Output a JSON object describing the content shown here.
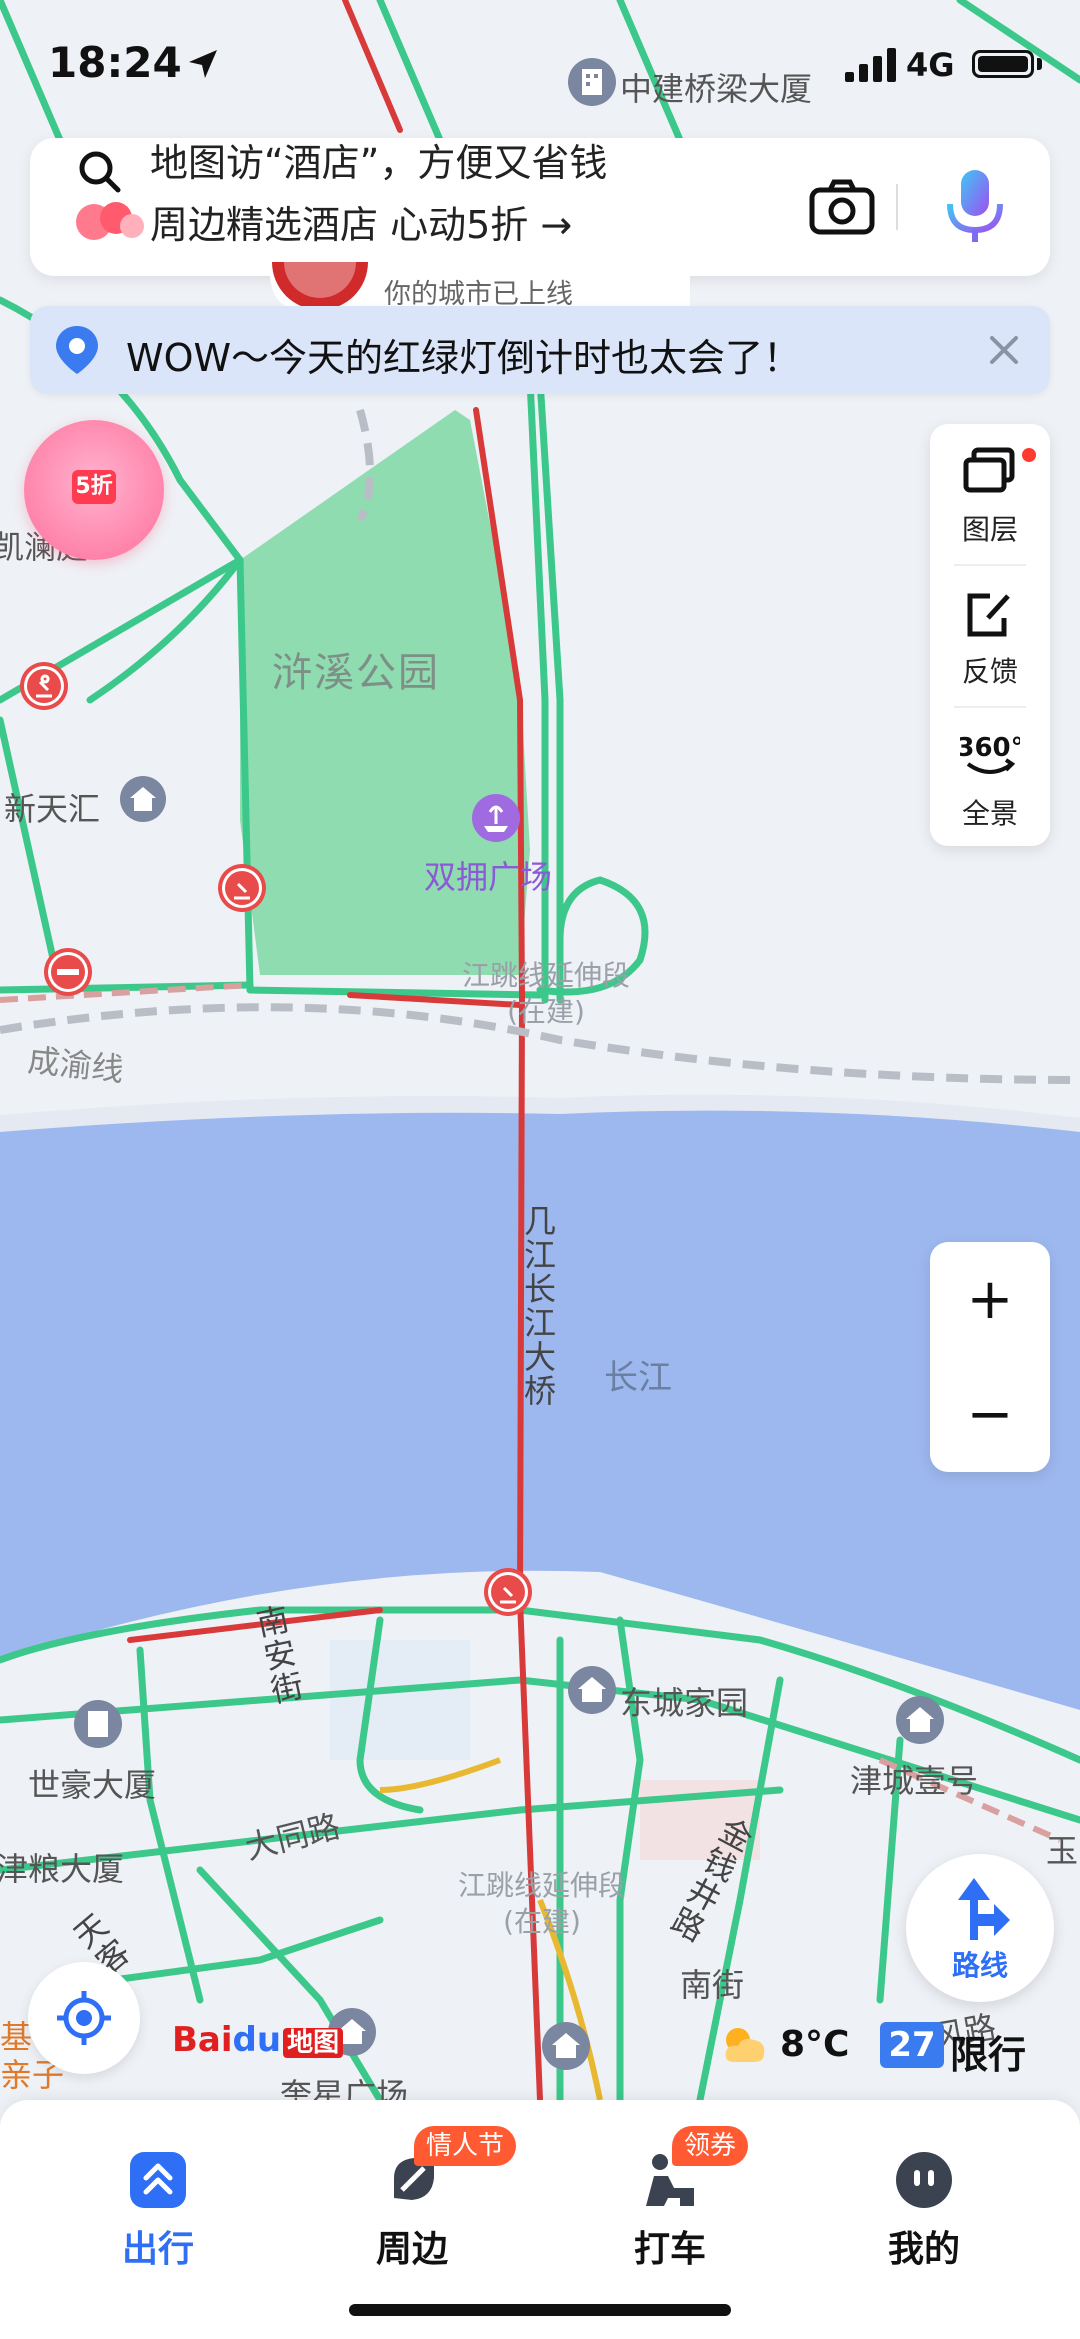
{
  "status_bar": {
    "time": "18:24",
    "network": "4G"
  },
  "search": {
    "line1": "地图访“酒店”，方便又省钱",
    "line2": "周边精选酒店 心动5折 →"
  },
  "city_banner": {
    "text": "你的城市已上线"
  },
  "notice": {
    "text": "WOW～今天的红绿灯倒计时也太会了！"
  },
  "promo": {
    "tag": "5折"
  },
  "tools": [
    {
      "label": "图层",
      "icon": "layers-icon"
    },
    {
      "label": "反馈",
      "icon": "feedback-icon"
    },
    {
      "label": "全景",
      "icon": "panorama-360-icon",
      "badge": "360°"
    }
  ],
  "zoom": {
    "in": "+",
    "out": "−"
  },
  "route": {
    "label": "路线"
  },
  "map_labels": {
    "top_building": "中建桥梁大厦",
    "lanting": "凯澜庭",
    "park": "浒溪公园",
    "xintianhui": "新天汇",
    "plaza": "双拥广场",
    "construction_1": "江跳线延伸段(在建)",
    "railway": "成渝线",
    "bridge": "几江长江大桥",
    "river": "长江",
    "nanan_street": "南安街",
    "dongcheng": "东城家园",
    "shihao": "世豪大厦",
    "datong": "大同路",
    "jincheng": "津城壹号",
    "jinliang": "津粮大厦",
    "yu": "玉",
    "jinqian": "金钱井路",
    "construction_2": "江跳线延伸段(在建)",
    "tianxiang": "天客",
    "nanjie": "南街",
    "changfeng": "长风路",
    "kuixing": "奎星广场",
    "ji": "基",
    "qinzi": "亲子"
  },
  "baidu_logo": {
    "bai": "Bai",
    "paw": "du",
    "ditu": "地图"
  },
  "weather": {
    "temperature": "8°C",
    "plate": "27",
    "restriction": "限行"
  },
  "bottom_nav": [
    {
      "label": "出行",
      "icon": "travel-icon",
      "active": true
    },
    {
      "label": "周边",
      "icon": "nearby-icon",
      "badge": "情人节"
    },
    {
      "label": "打车",
      "icon": "taxi-icon",
      "badge": "领券"
    },
    {
      "label": "我的",
      "icon": "profile-icon"
    }
  ],
  "colors": {
    "road_green": "#3cc88a",
    "road_red": "#d83a3a",
    "road_yellow": "#e8b830",
    "park": "#8fdcb0",
    "water": "#9db8ef",
    "accent": "#2f6ff5"
  }
}
